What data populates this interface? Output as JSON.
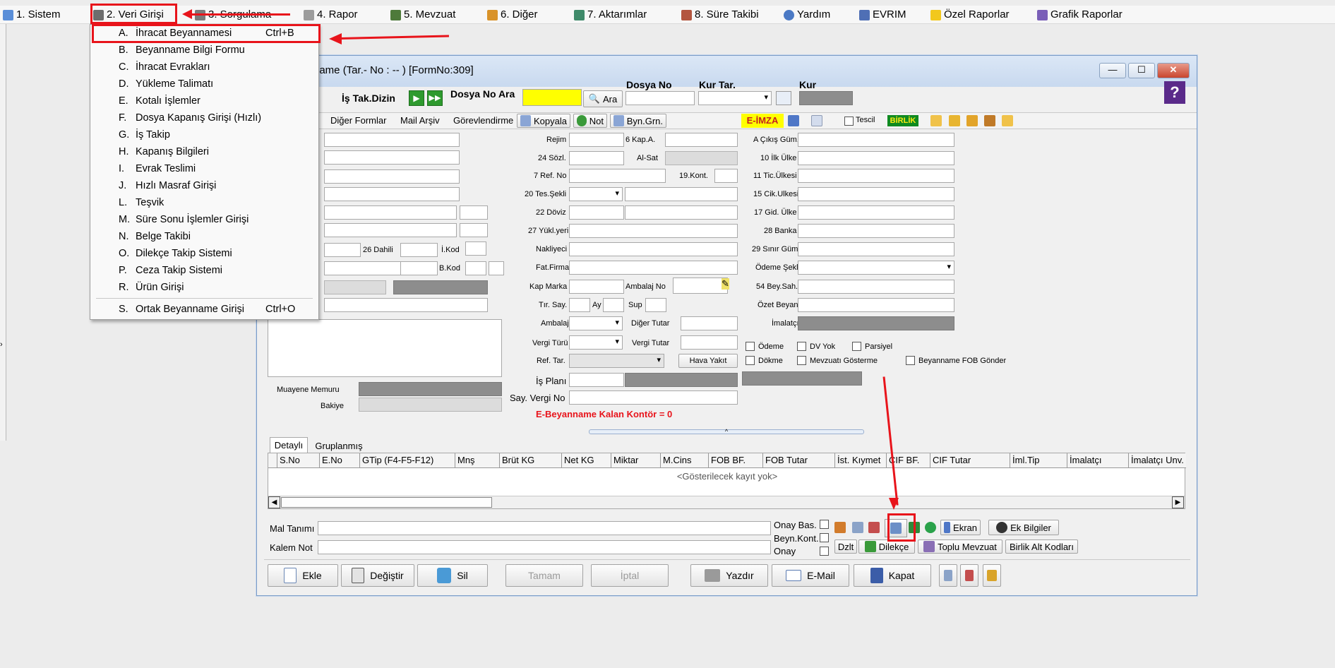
{
  "menubar": [
    {
      "label": "1.  Sistem"
    },
    {
      "label": "2.  Veri Girişi"
    },
    {
      "label": "3.  Sorgulama"
    },
    {
      "label": "4.  Rapor"
    },
    {
      "label": "5.  Mevzuat"
    },
    {
      "label": "6.  Diğer"
    },
    {
      "label": "7.  Aktarımlar"
    },
    {
      "label": "8. Süre Takibi"
    },
    {
      "label": "Yardım"
    },
    {
      "label": "EVRIM"
    },
    {
      "label": "Özel Raporlar"
    },
    {
      "label": "Grafik Raporlar"
    }
  ],
  "dropdown": [
    {
      "key": "A.",
      "label": "İhracat Beyannamesi",
      "shortcut": "Ctrl+B"
    },
    {
      "key": "B.",
      "label": "Beyanname Bilgi Formu"
    },
    {
      "key": "C.",
      "label": "İhracat Evrakları"
    },
    {
      "key": "D.",
      "label": "Yükleme Talimatı"
    },
    {
      "key": "E.",
      "label": "Kotalı İşlemler"
    },
    {
      "key": "F.",
      "label": "Dosya Kapanış Girişi (Hızlı)"
    },
    {
      "key": "G.",
      "label": "İş Takip"
    },
    {
      "key": "H.",
      "label": "Kapanış Bilgileri"
    },
    {
      "key": "I.",
      "label": "Evrak Teslimi"
    },
    {
      "key": "J.",
      "label": "Hızlı Masraf Girişi"
    },
    {
      "key": "L.",
      "label": "Teşvik"
    },
    {
      "key": "M.",
      "label": "Süre Sonu İşlemler Girişi"
    },
    {
      "key": "N.",
      "label": "Belge Takibi"
    },
    {
      "key": "O.",
      "label": "Dilekçe Takip Sistemi"
    },
    {
      "key": "P.",
      "label": "Ceza Takip Sistemi"
    },
    {
      "key": "R.",
      "label": "Ürün Girişi"
    },
    {
      "key": "S.",
      "label": "Ortak Beyanname Girişi",
      "shortcut": "Ctrl+O"
    }
  ],
  "window": {
    "title": "name (Tar.- No : --  ) [FormNo:309]",
    "min": "—",
    "max": "☐",
    "close": "✕",
    "help": "?"
  },
  "toolbar1": {
    "is_tak_dizin": "İş Tak.Dizin",
    "dosya_no_ara": "Dosya No Ara",
    "ara_btn": "Ara",
    "dosya_no": "Dosya No",
    "kur_tar": "Kur Tar.",
    "kur": "Kur"
  },
  "toolbar2": {
    "diger_formlar": "Diğer Formlar",
    "mail_arsiv": "Mail Arşiv",
    "gorevlendirme": "Görevlendirme",
    "kopyala": "Kopyala",
    "not": "Not",
    "byn_grn": "Byn.Grn.",
    "eimza": "E-İMZA",
    "tescil": "Tescil",
    "birlik": "BİRLİK"
  },
  "left_labels": {
    "dahili": "26 Dahili",
    "ikod": "İ.Kod",
    "bkod": "B.Kod",
    "muayene": "Muayene Memuru",
    "bakiye": "Bakiye"
  },
  "mid_labels": {
    "rejim": "Rejim",
    "kap6": "6 Kap.A.",
    "sozl": "24 Sözl.",
    "alsat": "Al-Sat",
    "ref7": "7 Ref. No",
    "kont19": "19.Kont.",
    "tes20": "20 Tes.Şekli",
    "doviz22": "22 Döviz",
    "yukl27": "27 Yükl.yeri",
    "nakliyeci": "Nakliyeci",
    "fatfirma": "Fat.Firma",
    "kapmarka": "Kap Marka",
    "ambalajno": "Ambalaj No",
    "tirsay": "Tır. Say.",
    "ay": "Ay",
    "sup": "Sup",
    "ambalaj": "Ambalaj",
    "digertutar": "Diğer Tutar",
    "vergiturü": "Vergi Türü",
    "vergitutar": "Vergi Tutar",
    "reftar": "Ref. Tar.",
    "havayakit": "Hava Yakıt",
    "isplani": "İş Planı",
    "sayvergi": "Say. Vergi No",
    "kontor": "E-Beyanname Kalan Kontör = 0"
  },
  "right_labels": {
    "cikis": "A Çıkış Güm.",
    "ilkulke": "10 İlk Ülke",
    "ticulke": "11 Tic.Ülkesi",
    "cikulke": "15 Cik.Ulkesi",
    "gidulke": "17 Gid. Ülke",
    "banka": "28 Banka",
    "sinir": "29 Sınır Güm.",
    "odeme": "Ödeme Şekli",
    "beysah": "54 Bey.Sah.",
    "ozet": "Özet Beyan",
    "imalatci": "İmalatçı"
  },
  "checks": {
    "odeme": "Ödeme",
    "dvyok": "DV Yok",
    "parsiyel": "Parsiyel",
    "dokme": "Dökme",
    "mevzuati": "Mevzuatı Gösterme",
    "fob": "Beyanname FOB Gönder"
  },
  "tabs": {
    "detayli": "Detaylı",
    "gruplanmis": "Gruplanmış"
  },
  "grid": {
    "columns": [
      "S.No",
      "E.No",
      "GTip (F4-F5-F12)",
      "Mnş",
      "Brüt KG",
      "Net KG",
      "Miktar",
      "M.Cins",
      "FOB BF.",
      "FOB Tutar",
      "İst. Kıymet",
      "CIF BF.",
      "CIF Tutar",
      "İml.Tip",
      "İmalatçı",
      "İmalatçı Unv."
    ],
    "empty": "<Gösterilecek kayıt yok>"
  },
  "bottom": {
    "mal_tanimi": "Mal Tanımı",
    "kalem_not": "Kalem Not",
    "onay_bas": "Onay Bas.",
    "beyn_kont": "Beyn.Kont.",
    "onay": "Onay",
    "ekran": "Ekran",
    "ek_bilgiler": "Ek Bilgiler",
    "dzlt": "Dzlt",
    "dilekce": "Dilekçe",
    "toplu_mevzuat": "Toplu Mevzuat",
    "birlik_alt": "Birlik Alt Kodları"
  },
  "actions": {
    "ekle": "Ekle",
    "degistir": "Değiştir",
    "sil": "Sil",
    "tamam": "Tamam",
    "iptal": "İptal",
    "yazdir": "Yazdır",
    "email": "E-Mail",
    "kapat": "Kapat"
  },
  "colors": {
    "highlight": "#e8141b",
    "yellow": "#ffff00",
    "gray_field": "#8d8d8d"
  }
}
